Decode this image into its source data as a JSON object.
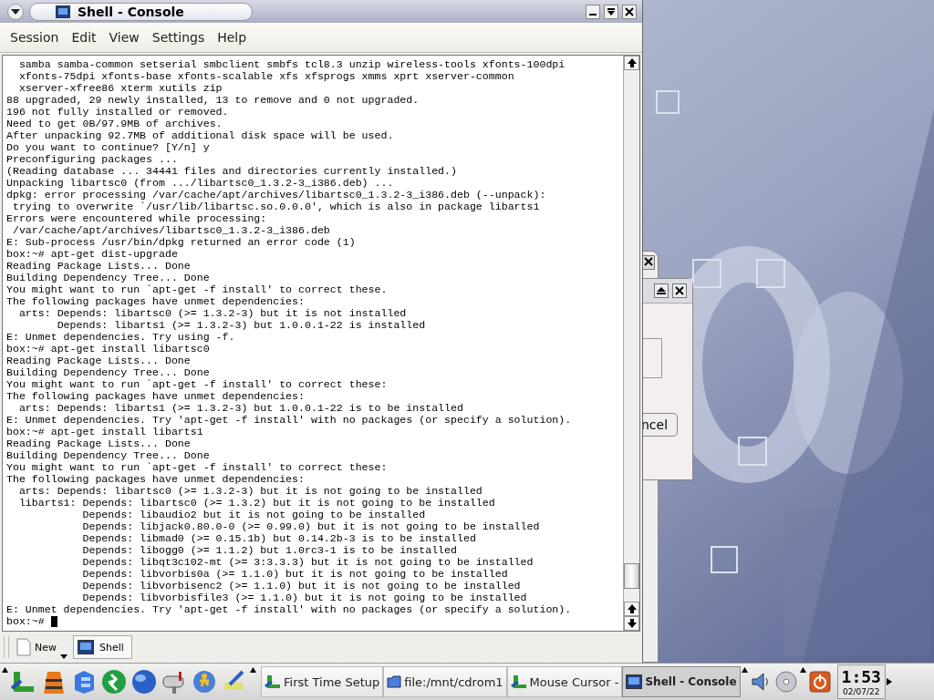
{
  "window": {
    "title": "Shell - Console"
  },
  "menu": [
    "Session",
    "Edit",
    "View",
    "Settings",
    "Help"
  ],
  "terminal": {
    "cursor": true,
    "lines": [
      "  samba samba-common setserial smbclient smbfs tcl8.3 unzip wireless-tools xfonts-100dpi",
      "  xfonts-75dpi xfonts-base xfonts-scalable xfs xfsprogs xmms xprt xserver-common",
      "  xserver-xfree86 xterm xutils zip",
      "88 upgraded, 29 newly installed, 13 to remove and 0 not upgraded.",
      "196 not fully installed or removed.",
      "Need to get 0B/97.9MB of archives.",
      "After unpacking 92.7MB of additional disk space will be used.",
      "Do you want to continue? [Y/n] y",
      "Preconfiguring packages ...",
      "(Reading database ... 34441 files and directories currently installed.)",
      "Unpacking libartsc0 (from .../libartsc0_1.3.2-3_i386.deb) ...",
      "dpkg: error processing /var/cache/apt/archives/libartsc0_1.3.2-3_i386.deb (--unpack):",
      " trying to overwrite `/usr/lib/libartsc.so.0.0.0', which is also in package libarts1",
      "Errors were encountered while processing:",
      " /var/cache/apt/archives/libartsc0_1.3.2-3_i386.deb",
      "E: Sub-process /usr/bin/dpkg returned an error code (1)",
      "box:~# apt-get dist-upgrade",
      "Reading Package Lists... Done",
      "Building Dependency Tree... Done",
      "You might want to run `apt-get -f install' to correct these.",
      "The following packages have unmet dependencies:",
      "  arts: Depends: libartsc0 (>= 1.3.2-3) but it is not installed",
      "        Depends: libarts1 (>= 1.3.2-3) but 1.0.0.1-22 is installed",
      "E: Unmet dependencies. Try using -f.",
      "box:~# apt-get install libartsc0",
      "Reading Package Lists... Done",
      "Building Dependency Tree... Done",
      "You might want to run `apt-get -f install' to correct these:",
      "The following packages have unmet dependencies:",
      "  arts: Depends: libarts1 (>= 1.3.2-3) but 1.0.0.1-22 is to be installed",
      "E: Unmet dependencies. Try 'apt-get -f install' with no packages (or specify a solution).",
      "box:~# apt-get install libarts1",
      "Reading Package Lists... Done",
      "Building Dependency Tree... Done",
      "You might want to run `apt-get -f install' to correct these:",
      "The following packages have unmet dependencies:",
      "  arts: Depends: libartsc0 (>= 1.3.2-3) but it is not going to be installed",
      "  libarts1: Depends: libartsc0 (>= 1.3.2) but it is not going to be installed",
      "            Depends: libaudio2 but it is not going to be installed",
      "            Depends: libjack0.80.0-0 (>= 0.99.0) but it is not going to be installed",
      "            Depends: libmad0 (>= 0.15.1b) but 0.14.2b-3 is to be installed",
      "            Depends: libogg0 (>= 1.1.2) but 1.0rc3-1 is to be installed",
      "            Depends: libqt3c102-mt (>= 3:3.3.3) but it is not going to be installed",
      "            Depends: libvorbis0a (>= 1.1.0) but it is not going to be installed",
      "            Depends: libvorbisenc2 (>= 1.1.0) but it is not going to be installed",
      "            Depends: libvorbisfile3 (>= 1.1.0) but it is not going to be installed",
      "E: Unmet dependencies. Try 'apt-get -f install' with no packages (or specify a solution).",
      "box:~# "
    ]
  },
  "session_bar": {
    "new_button": "New",
    "tabs": [
      {
        "label": "Shell",
        "selected": true
      }
    ]
  },
  "background_dialog": {
    "button": "ncel"
  },
  "taskbar": {
    "tasks": [
      {
        "label": "First Time Setup",
        "kind": "wizard",
        "selected": false
      },
      {
        "label": "file:/mnt/cdrom1",
        "kind": "folder",
        "selected": false
      },
      {
        "label": "Mouse Cursor -",
        "kind": "wizard",
        "selected": false
      },
      {
        "label": "Shell - Console",
        "kind": "terminal",
        "selected": true
      }
    ],
    "clock": {
      "time": "1:53",
      "date": "02/07/22"
    }
  }
}
